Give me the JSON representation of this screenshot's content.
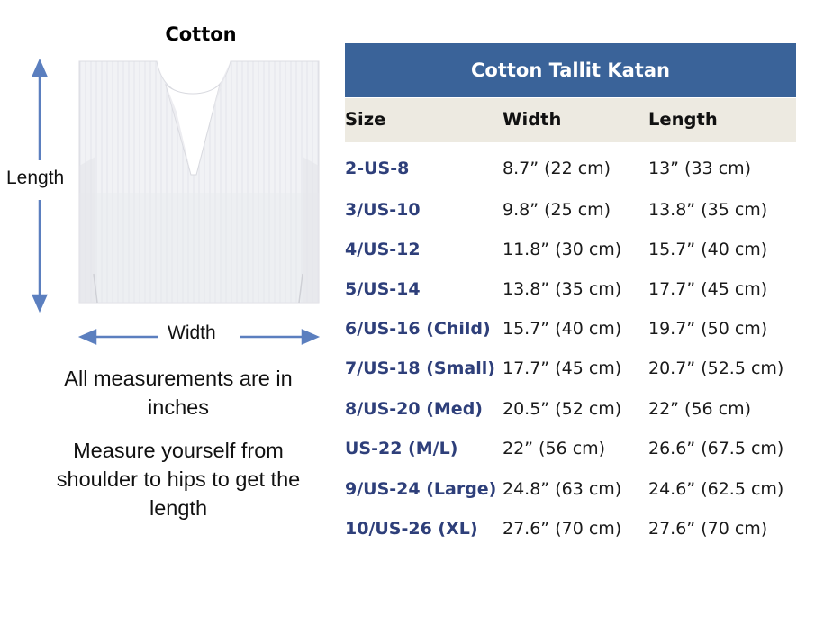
{
  "garment": {
    "title": "Cotton",
    "length_label": "Length",
    "width_label": "Width"
  },
  "notes": {
    "line1": "All measurements are in inches",
    "line2": "Measure yourself from shoulder to hips to get the length"
  },
  "table": {
    "title": "Cotton Tallit Katan",
    "columns": [
      "Size",
      "Width",
      "Length"
    ],
    "rows": [
      [
        "2-US-8",
        "8.7” (22 cm)",
        "13” (33 cm)"
      ],
      [
        "3/US-10",
        "9.8” (25 cm)",
        "13.8” (35 cm)"
      ],
      [
        "4/US-12",
        "11.8” (30 cm)",
        "15.7” (40 cm)"
      ],
      [
        "5/US-14",
        "13.8” (35 cm)",
        "17.7” (45 cm)"
      ],
      [
        "6/US-16 (Child)",
        "15.7” (40 cm)",
        "19.7” (50 cm)"
      ],
      [
        "7/US-18 (Small)",
        "17.7” (45 cm)",
        "20.7” (52.5 cm)"
      ],
      [
        "8/US-20 (Med)",
        "20.5” (52 cm)",
        "22” (56 cm)"
      ],
      [
        "US-22 (M/L)",
        "22” (56 cm)",
        "26.6” (67.5 cm)"
      ],
      [
        "9/US-24 (Large)",
        "24.8” (63 cm)",
        "24.6” (62.5 cm)"
      ],
      [
        "10/US-26 (XL)",
        "27.6” (70 cm)",
        "27.6” (70 cm)"
      ]
    ]
  },
  "colors": {
    "header_bg": "#3a6399",
    "column_header_bg": "#edeae1",
    "size_text": "#2e3f7a",
    "arrow": "#5b7fbf"
  }
}
